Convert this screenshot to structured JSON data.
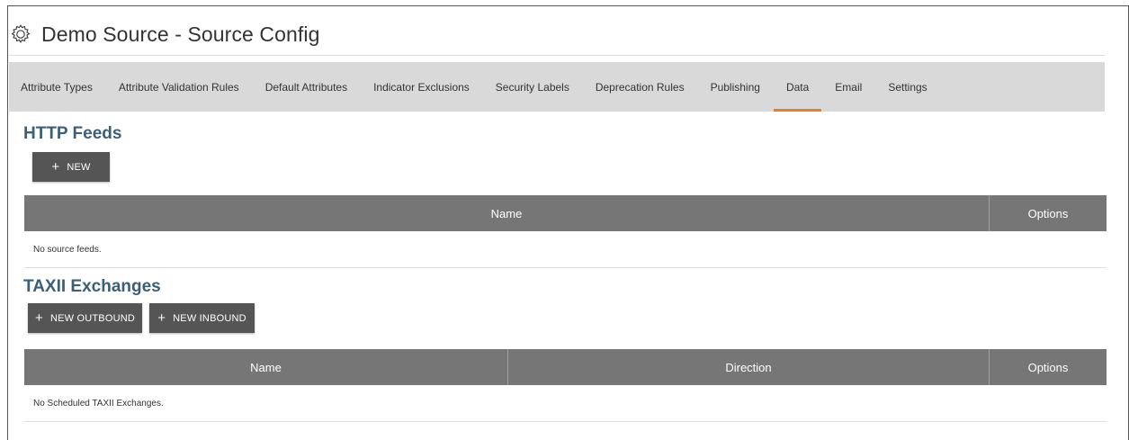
{
  "header": {
    "icon": "gear-icon",
    "title": "Demo Source - Source Config"
  },
  "tabs": [
    {
      "label": "Attribute Types",
      "active": false
    },
    {
      "label": "Attribute Validation Rules",
      "active": false
    },
    {
      "label": "Default Attributes",
      "active": false
    },
    {
      "label": "Indicator Exclusions",
      "active": false
    },
    {
      "label": "Security Labels",
      "active": false
    },
    {
      "label": "Deprecation Rules",
      "active": false
    },
    {
      "label": "Publishing",
      "active": false
    },
    {
      "label": "Data",
      "active": true
    },
    {
      "label": "Email",
      "active": false
    },
    {
      "label": "Settings",
      "active": false
    }
  ],
  "http_feeds": {
    "title": "HTTP Feeds",
    "new_button": {
      "icon": "plus-icon",
      "label": "NEW"
    },
    "columns": [
      "Name",
      "Options"
    ],
    "empty_text": "No source feeds."
  },
  "taxii": {
    "title": "TAXII Exchanges",
    "new_outbound_button": {
      "icon": "plus-icon",
      "label": "NEW OUTBOUND"
    },
    "new_inbound_button": {
      "icon": "plus-icon",
      "label": "NEW INBOUND"
    },
    "columns": [
      "Name",
      "Direction",
      "Options"
    ],
    "empty_text": "No Scheduled TAXII Exchanges."
  },
  "colors": {
    "accent": "#f07c1e",
    "section_title": "#3c5f78",
    "table_header": "#767676",
    "button": "#555555",
    "tabbar": "#d9d9d9"
  }
}
